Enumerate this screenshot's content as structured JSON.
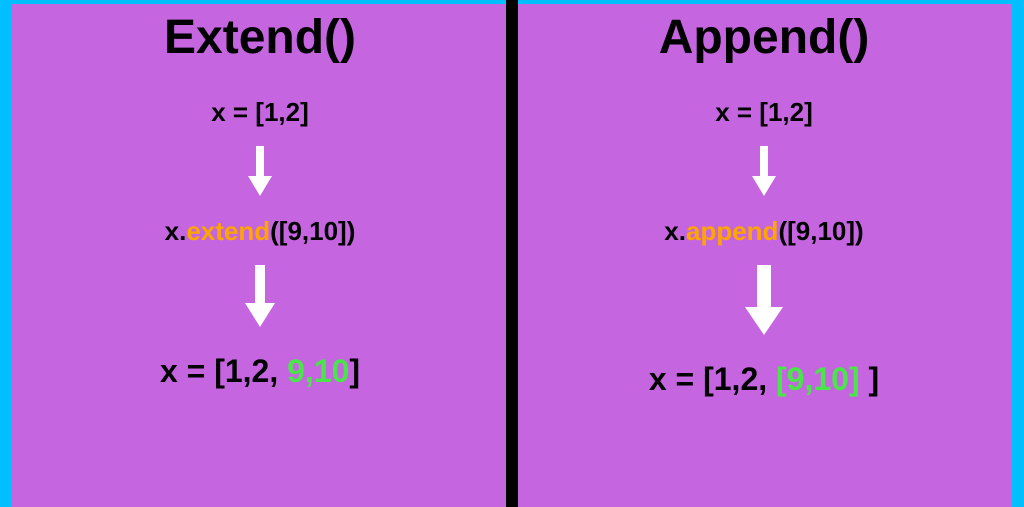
{
  "left": {
    "title": "Extend()",
    "initial": "x = [1,2]",
    "call_prefix": "x.",
    "call_method": "extend",
    "call_suffix": "([9,10])",
    "result_prefix": "x = [1,2, ",
    "result_added": "9,10",
    "result_suffix": "]"
  },
  "right": {
    "title": "Append()",
    "initial": "x = [1,2]",
    "call_prefix": "x.",
    "call_method": "append",
    "call_suffix": "([9,10])",
    "result_prefix": "x = [1,2, ",
    "result_added": "[9,10]",
    "result_suffix": " ]"
  },
  "colors": {
    "background": "#c565e0",
    "method": "#ffa500",
    "added": "#4ae54a",
    "arrow": "#ffffff"
  }
}
